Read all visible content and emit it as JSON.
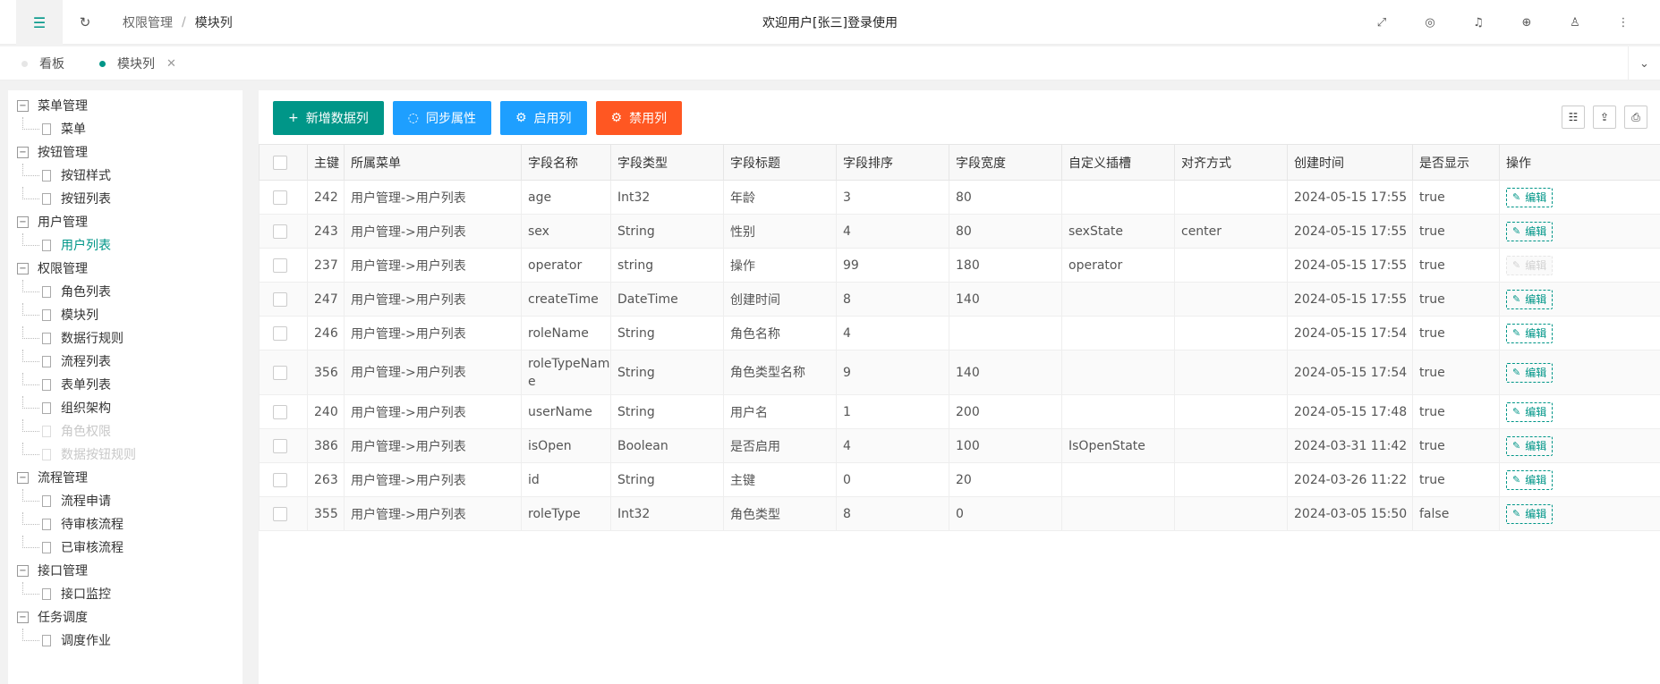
{
  "header": {
    "breadcrumb": [
      "权限管理",
      "模块列"
    ],
    "breadcrumb_sep": "/",
    "welcome": "欢迎用户[张三]登录使用"
  },
  "tabs": [
    {
      "label": "看板",
      "active": false
    },
    {
      "label": "模块列",
      "active": true
    }
  ],
  "sidebar": {
    "groups": [
      {
        "label": "菜单管理",
        "items": [
          {
            "label": "菜单"
          }
        ]
      },
      {
        "label": "按钮管理",
        "items": [
          {
            "label": "按钮样式"
          },
          {
            "label": "按钮列表"
          }
        ]
      },
      {
        "label": "用户管理",
        "items": [
          {
            "label": "用户列表",
            "active": true
          }
        ]
      },
      {
        "label": "权限管理",
        "items": [
          {
            "label": "角色列表"
          },
          {
            "label": "模块列"
          },
          {
            "label": "数据行规则"
          },
          {
            "label": "流程列表"
          },
          {
            "label": "表单列表"
          },
          {
            "label": "组织架构"
          },
          {
            "label": "角色权限",
            "disabled": true
          },
          {
            "label": "数据按钮规则",
            "disabled": true
          }
        ]
      },
      {
        "label": "流程管理",
        "items": [
          {
            "label": "流程申请"
          },
          {
            "label": "待审核流程"
          },
          {
            "label": "已审核流程"
          }
        ]
      },
      {
        "label": "接口管理",
        "items": [
          {
            "label": "接口监控"
          }
        ]
      },
      {
        "label": "任务调度",
        "items": [
          {
            "label": "调度作业"
          }
        ]
      }
    ]
  },
  "toolbar": {
    "buttons": [
      {
        "label": "新增数据列",
        "icon": "plus-icon",
        "color": "#009688"
      },
      {
        "label": "同步属性",
        "icon": "loading-icon",
        "color": "#1e9fff"
      },
      {
        "label": "启用列",
        "icon": "gear-icon",
        "color": "#1e9fff"
      },
      {
        "label": "禁用列",
        "icon": "gear-icon",
        "color": "#ff5722"
      }
    ]
  },
  "table": {
    "columns": [
      "主键",
      "所属菜单",
      "字段名称",
      "字段类型",
      "字段标题",
      "字段排序",
      "字段宽度",
      "自定义插槽",
      "对齐方式",
      "创建时间",
      "是否显示",
      "操作"
    ],
    "edit_label": "编辑",
    "rows": [
      {
        "id": "242",
        "menu": "用户管理->用户列表",
        "name": "age",
        "type": "Int32",
        "title": "年龄",
        "sort": "3",
        "width": "80",
        "slot": "",
        "align": "",
        "created": "2024-05-15 17:55",
        "show": "true",
        "edit_disabled": false
      },
      {
        "id": "243",
        "menu": "用户管理->用户列表",
        "name": "sex",
        "type": "String",
        "title": "性别",
        "sort": "4",
        "width": "80",
        "slot": "sexState",
        "align": "center",
        "created": "2024-05-15 17:55",
        "show": "true",
        "edit_disabled": false
      },
      {
        "id": "237",
        "menu": "用户管理->用户列表",
        "name": "operator",
        "type": "string",
        "title": "操作",
        "sort": "99",
        "width": "180",
        "slot": "operator",
        "align": "",
        "created": "2024-05-15 17:55",
        "show": "true",
        "edit_disabled": true
      },
      {
        "id": "247",
        "menu": "用户管理->用户列表",
        "name": "createTime",
        "type": "DateTime",
        "title": "创建时间",
        "sort": "8",
        "width": "140",
        "slot": "",
        "align": "",
        "created": "2024-05-15 17:55",
        "show": "true",
        "edit_disabled": false
      },
      {
        "id": "246",
        "menu": "用户管理->用户列表",
        "name": "roleName",
        "type": "String",
        "title": "角色名称",
        "sort": "4",
        "width": "",
        "slot": "",
        "align": "",
        "created": "2024-05-15 17:54",
        "show": "true",
        "edit_disabled": false
      },
      {
        "id": "356",
        "menu": "用户管理->用户列表",
        "name": "roleTypeName",
        "type": "String",
        "title": "角色类型名称",
        "sort": "9",
        "width": "140",
        "slot": "",
        "align": "",
        "created": "2024-05-15 17:54",
        "show": "true",
        "edit_disabled": false
      },
      {
        "id": "240",
        "menu": "用户管理->用户列表",
        "name": "userName",
        "type": "String",
        "title": "用户名",
        "sort": "1",
        "width": "200",
        "slot": "",
        "align": "",
        "created": "2024-05-15 17:48",
        "show": "true",
        "edit_disabled": false
      },
      {
        "id": "386",
        "menu": "用户管理->用户列表",
        "name": "isOpen",
        "type": "Boolean",
        "title": "是否启用",
        "sort": "4",
        "width": "100",
        "slot": "IsOpenState",
        "align": "",
        "created": "2024-03-31 11:42",
        "show": "true",
        "edit_disabled": false
      },
      {
        "id": "263",
        "menu": "用户管理->用户列表",
        "name": "id",
        "type": "String",
        "title": "主键",
        "sort": "0",
        "width": "20",
        "slot": "",
        "align": "",
        "created": "2024-03-26 11:22",
        "show": "true",
        "edit_disabled": false
      },
      {
        "id": "355",
        "menu": "用户管理->用户列表",
        "name": "roleType",
        "type": "Int32",
        "title": "角色类型",
        "sort": "8",
        "width": "0",
        "slot": "",
        "align": "",
        "created": "2024-03-05 15:50",
        "show": "false",
        "edit_disabled": false
      }
    ]
  }
}
